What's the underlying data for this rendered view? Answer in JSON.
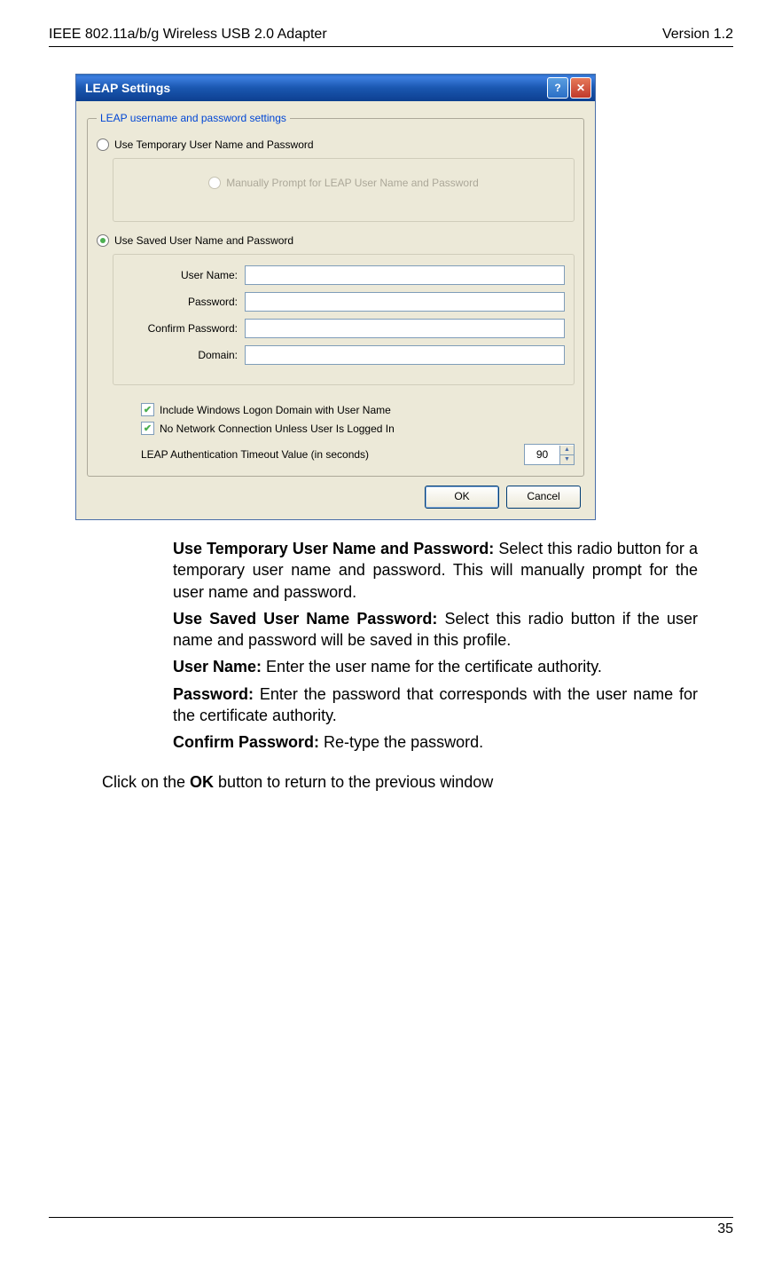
{
  "header": {
    "left": "IEEE 802.11a/b/g Wireless USB 2.0 Adapter",
    "right": "Version 1.2"
  },
  "dialog": {
    "title": "LEAP Settings",
    "groupTitle": "LEAP username and password settings",
    "radioTemp": "Use Temporary User Name and Password",
    "radioManual": "Manually Prompt for LEAP User Name and Password",
    "radioSaved": "Use Saved User Name and Password",
    "labels": {
      "user": "User Name:",
      "pass": "Password:",
      "confirm": "Confirm Password:",
      "domain": "Domain:"
    },
    "checks": {
      "includeDomain": "Include Windows Logon Domain with User Name",
      "noNetwork": "No Network Connection Unless User Is Logged In"
    },
    "timeoutLabel": "LEAP Authentication Timeout Value (in seconds)",
    "timeoutValue": "90",
    "ok": "OK",
    "cancel": "Cancel"
  },
  "bullets": {
    "b1_label": "Use Temporary User Name and Password:",
    "b1_text": " Select this radio button for a temporary user name and password. This will manually prompt for the user name and password.",
    "b2_label": "Use Saved User Name Password:",
    "b2_text": " Select this radio button if the user name and password will be saved in this profile.",
    "b3_label": "User Name:",
    "b3_text": " Enter the user name for the certificate authority.",
    "b4_label": "Password:",
    "b4_text": " Enter the password that corresponds with the user name for the certificate authority.",
    "b5_label": "Confirm Password:",
    "b5_text": " Re-type the password."
  },
  "closing": {
    "pre": "Click on the ",
    "bold": "OK",
    "post": " button to return to the previous window"
  },
  "footer": {
    "page": "35"
  }
}
